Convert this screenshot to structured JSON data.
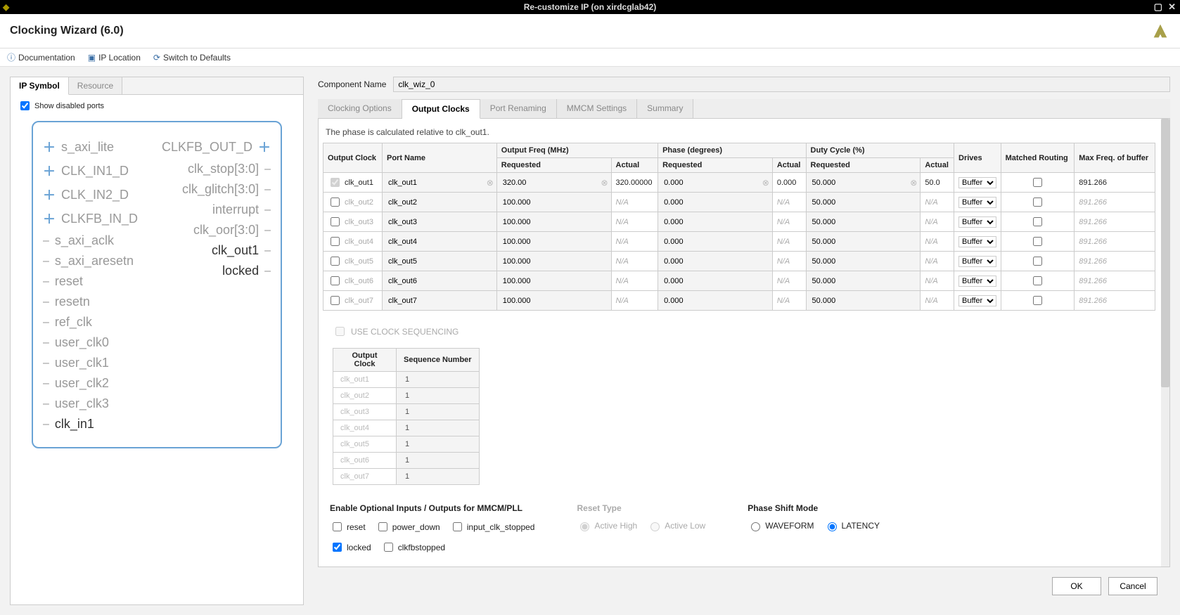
{
  "titlebar": {
    "title": "Re-customize IP (on xirdcglab42)"
  },
  "header": {
    "title": "Clocking Wizard (6.0)"
  },
  "toolbar": {
    "doc": "Documentation",
    "iploc": "IP Location",
    "defaults": "Switch to Defaults"
  },
  "left": {
    "tabs": {
      "symbol": "IP Symbol",
      "resource": "Resource"
    },
    "show_disabled": "Show disabled ports",
    "left_ports": [
      {
        "label": "s_axi_lite",
        "type": "bus",
        "disabled": true
      },
      {
        "label": "CLK_IN1_D",
        "type": "bus",
        "disabled": true
      },
      {
        "label": "CLK_IN2_D",
        "type": "bus",
        "disabled": true
      },
      {
        "label": "CLKFB_IN_D",
        "type": "bus",
        "disabled": true
      },
      {
        "label": "s_axi_aclk",
        "type": "wire",
        "disabled": true
      },
      {
        "label": "s_axi_aresetn",
        "type": "wire",
        "disabled": true
      },
      {
        "label": "reset",
        "type": "wire",
        "disabled": true
      },
      {
        "label": "resetn",
        "type": "wire",
        "disabled": true
      },
      {
        "label": "ref_clk",
        "type": "wire",
        "disabled": true
      },
      {
        "label": "user_clk0",
        "type": "wire",
        "disabled": true
      },
      {
        "label": "user_clk1",
        "type": "wire",
        "disabled": true
      },
      {
        "label": "user_clk2",
        "type": "wire",
        "disabled": true
      },
      {
        "label": "user_clk3",
        "type": "wire",
        "disabled": true
      },
      {
        "label": "clk_in1",
        "type": "wire",
        "disabled": false
      }
    ],
    "right_ports": [
      {
        "label": "CLKFB_OUT_D",
        "type": "bus",
        "disabled": true
      },
      {
        "label": "clk_stop[3:0]",
        "type": "wire",
        "disabled": true
      },
      {
        "label": "clk_glitch[3:0]",
        "type": "wire",
        "disabled": true
      },
      {
        "label": "interrupt",
        "type": "wire",
        "disabled": true
      },
      {
        "label": "clk_oor[3:0]",
        "type": "wire",
        "disabled": true
      },
      {
        "label": "clk_out1",
        "type": "wire",
        "disabled": false
      },
      {
        "label": "locked",
        "type": "wire",
        "disabled": false
      }
    ]
  },
  "right": {
    "component_name_label": "Component Name",
    "component_name_value": "clk_wiz_0",
    "tabs": {
      "clocking_options": "Clocking Options",
      "output_clocks": "Output Clocks",
      "port_renaming": "Port Renaming",
      "mmcm_settings": "MMCM Settings",
      "summary": "Summary"
    },
    "phase_note": "The phase is calculated relative to clk_out1.",
    "clocks_headers": {
      "output_clock": "Output Clock",
      "port_name": "Port Name",
      "freq": "Output Freq (MHz)",
      "requested": "Requested",
      "actual": "Actual",
      "phase": "Phase (degrees)",
      "duty": "Duty Cycle (%)",
      "drives": "Drives",
      "matched": "Matched Routing",
      "maxfreq": "Max Freq. of buffer"
    },
    "clocks": [
      {
        "enabled": true,
        "enabled_locked": true,
        "name": "clk_out1",
        "port": "clk_out1",
        "freq_req": "320.00",
        "freq_act": "320.00000",
        "phase_req": "0.000",
        "phase_act": "0.000",
        "duty_req": "50.000",
        "duty_act": "50.0",
        "drive": "Buffer",
        "matched": false,
        "maxfreq": "891.266"
      },
      {
        "enabled": false,
        "enabled_locked": false,
        "name": "clk_out2",
        "port": "clk_out2",
        "freq_req": "100.000",
        "freq_act": "N/A",
        "phase_req": "0.000",
        "phase_act": "N/A",
        "duty_req": "50.000",
        "duty_act": "N/A",
        "drive": "Buffer",
        "matched": false,
        "maxfreq": "891.266"
      },
      {
        "enabled": false,
        "enabled_locked": false,
        "name": "clk_out3",
        "port": "clk_out3",
        "freq_req": "100.000",
        "freq_act": "N/A",
        "phase_req": "0.000",
        "phase_act": "N/A",
        "duty_req": "50.000",
        "duty_act": "N/A",
        "drive": "Buffer",
        "matched": false,
        "maxfreq": "891.266"
      },
      {
        "enabled": false,
        "enabled_locked": false,
        "name": "clk_out4",
        "port": "clk_out4",
        "freq_req": "100.000",
        "freq_act": "N/A",
        "phase_req": "0.000",
        "phase_act": "N/A",
        "duty_req": "50.000",
        "duty_act": "N/A",
        "drive": "Buffer",
        "matched": false,
        "maxfreq": "891.266"
      },
      {
        "enabled": false,
        "enabled_locked": false,
        "name": "clk_out5",
        "port": "clk_out5",
        "freq_req": "100.000",
        "freq_act": "N/A",
        "phase_req": "0.000",
        "phase_act": "N/A",
        "duty_req": "50.000",
        "duty_act": "N/A",
        "drive": "Buffer",
        "matched": false,
        "maxfreq": "891.266"
      },
      {
        "enabled": false,
        "enabled_locked": false,
        "name": "clk_out6",
        "port": "clk_out6",
        "freq_req": "100.000",
        "freq_act": "N/A",
        "phase_req": "0.000",
        "phase_act": "N/A",
        "duty_req": "50.000",
        "duty_act": "N/A",
        "drive": "Buffer",
        "matched": false,
        "maxfreq": "891.266"
      },
      {
        "enabled": false,
        "enabled_locked": false,
        "name": "clk_out7",
        "port": "clk_out7",
        "freq_req": "100.000",
        "freq_act": "N/A",
        "phase_req": "0.000",
        "phase_act": "N/A",
        "duty_req": "50.000",
        "duty_act": "N/A",
        "drive": "Buffer",
        "matched": false,
        "maxfreq": "891.266"
      }
    ],
    "seq_label": "USE CLOCK SEQUENCING",
    "seq_headers": {
      "oc": "Output Clock",
      "sn": "Sequence Number"
    },
    "seq_rows": [
      {
        "name": "clk_out1",
        "seq": "1"
      },
      {
        "name": "clk_out2",
        "seq": "1"
      },
      {
        "name": "clk_out3",
        "seq": "1"
      },
      {
        "name": "clk_out4",
        "seq": "1"
      },
      {
        "name": "clk_out5",
        "seq": "1"
      },
      {
        "name": "clk_out6",
        "seq": "1"
      },
      {
        "name": "clk_out7",
        "seq": "1"
      }
    ],
    "optional_io": {
      "title": "Enable Optional Inputs / Outputs for MMCM/PLL",
      "reset": "reset",
      "power_down": "power_down",
      "input_clk_stopped": "input_clk_stopped",
      "locked": "locked",
      "clkfbstopped": "clkfbstopped"
    },
    "reset_type": {
      "title": "Reset Type",
      "active_high": "Active High",
      "active_low": "Active Low"
    },
    "phase_shift": {
      "title": "Phase Shift Mode",
      "waveform": "WAVEFORM",
      "latency": "LATENCY"
    }
  },
  "footer": {
    "ok": "OK",
    "cancel": "Cancel"
  }
}
